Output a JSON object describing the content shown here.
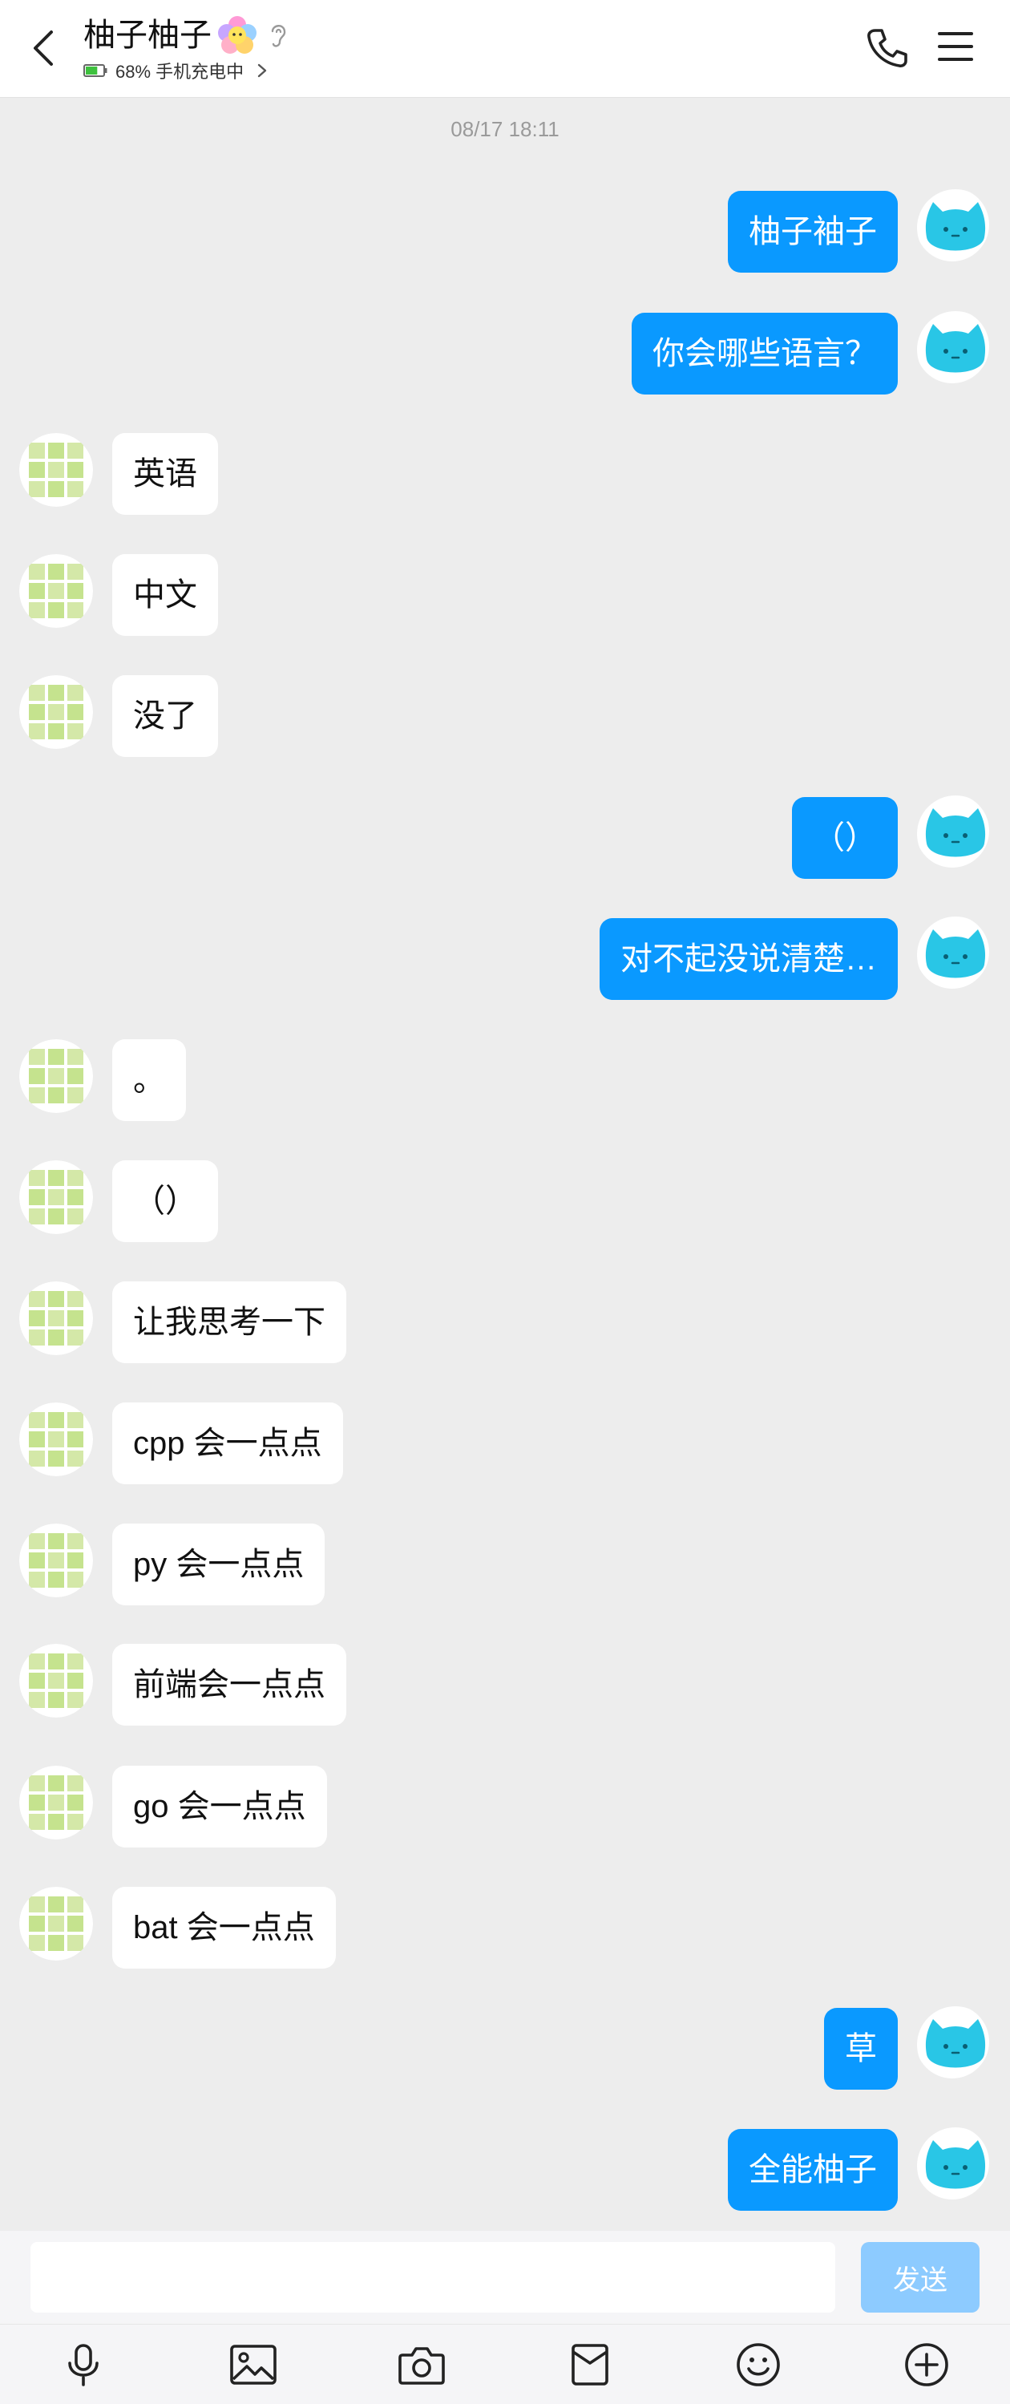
{
  "header": {
    "title": "柚子柚子",
    "status": "68% 手机充电中",
    "battery_level": 0.68,
    "icons": [
      "back-icon",
      "flower-badge-icon",
      "ear-icon",
      "battery-icon",
      "chevron-right-icon",
      "phone-icon",
      "menu-icon"
    ]
  },
  "chat": {
    "timestamp": "08/17 18:11",
    "messages": [
      {
        "dir": "out",
        "text": "柚子袖子"
      },
      {
        "dir": "out",
        "text": "你会哪些语言？"
      },
      {
        "dir": "in",
        "text": "英语"
      },
      {
        "dir": "in",
        "text": "中文"
      },
      {
        "dir": "in",
        "text": "没了"
      },
      {
        "dir": "out",
        "text": "（）"
      },
      {
        "dir": "out",
        "text": "对不起没说清楚…"
      },
      {
        "dir": "in",
        "text": "。"
      },
      {
        "dir": "in",
        "text": "（）"
      },
      {
        "dir": "in",
        "text": "让我思考一下"
      },
      {
        "dir": "in",
        "text": "cpp 会一点点"
      },
      {
        "dir": "in",
        "text": "py 会一点点"
      },
      {
        "dir": "in",
        "text": "前端会一点点"
      },
      {
        "dir": "in",
        "text": "go 会一点点"
      },
      {
        "dir": "in",
        "text": "bat 会一点点"
      },
      {
        "dir": "out",
        "text": "草"
      },
      {
        "dir": "out",
        "text": "全能柚子"
      }
    ]
  },
  "input": {
    "value": "",
    "placeholder": "",
    "send_label": "发送"
  },
  "toolbar": {
    "icons": [
      "microphone-icon",
      "image-icon",
      "camera-icon",
      "red-packet-icon",
      "emoji-icon",
      "plus-icon"
    ]
  },
  "colors": {
    "outgoing_bubble": "#0a99ff",
    "incoming_bubble": "#ffffff",
    "send_button": "#8dcbff",
    "background": "#ededed"
  }
}
